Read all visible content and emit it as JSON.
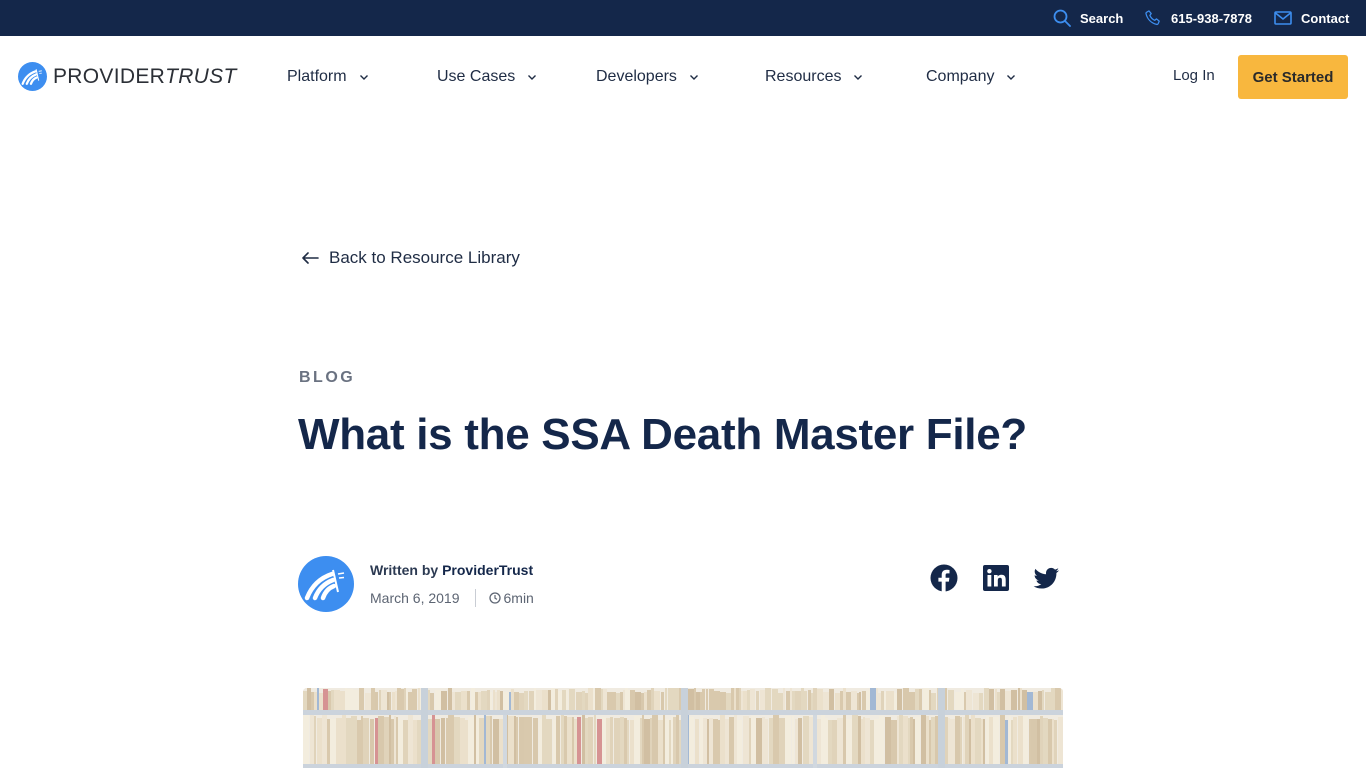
{
  "topbar": {
    "search_label": "Search",
    "phone_label": "615-938-7878",
    "contact_label": "Contact"
  },
  "brand": {
    "name_part1": "PROVIDER",
    "name_part2": "TRUST",
    "accent_color": "#3d8ef0",
    "navy_color": "#14274a",
    "cta_color": "#f8b73e"
  },
  "nav": {
    "items": [
      {
        "label": "Platform"
      },
      {
        "label": "Use Cases"
      },
      {
        "label": "Developers"
      },
      {
        "label": "Resources"
      },
      {
        "label": "Company"
      }
    ],
    "login_label": "Log In",
    "cta_label": "Get Started"
  },
  "article": {
    "back_label": "Back to Resource Library",
    "category": "BLOG",
    "title": "What is the SSA Death Master File?",
    "author_prefix": "Written by",
    "author_name": "ProviderTrust",
    "date": "March 6, 2019",
    "read_time": "6min",
    "share": [
      {
        "icon": "facebook-icon"
      },
      {
        "icon": "linkedin-icon"
      },
      {
        "icon": "twitter-icon"
      }
    ],
    "hero_image_alt": "Shelves of old paper files"
  }
}
